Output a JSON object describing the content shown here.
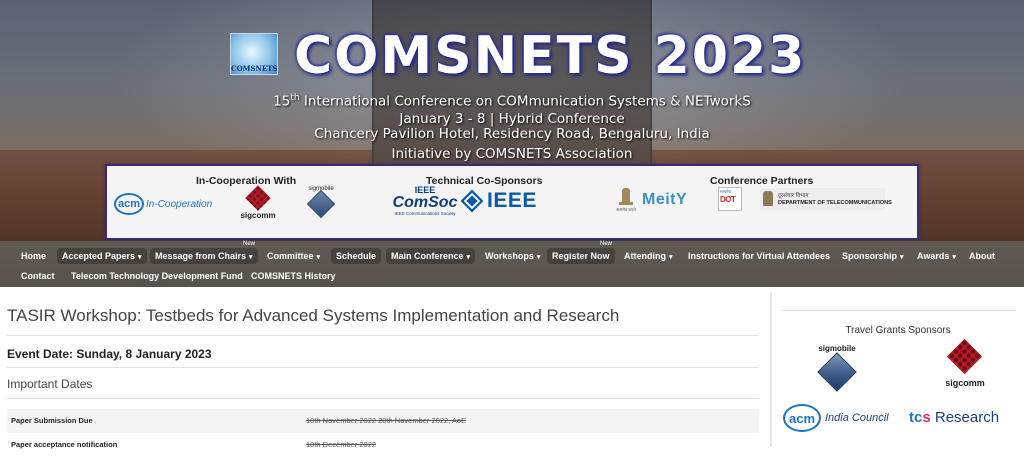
{
  "header": {
    "logo_text": "COMSNETS",
    "title": "COMSNETS 2023",
    "subtitle_ordinal": "15",
    "subtitle_suffix": "th",
    "subtitle_rest": " International Conference on COMmunication Systems & NETworkS",
    "dates_line": "January 3 - 8 | Hybrid Conference",
    "venue_line": "Chancery Pavilion Hotel, Residency Road, Bengaluru, India",
    "initiative_line": "Initiative by COMSNETS Association"
  },
  "sponsors_panel": {
    "cooperation_heading": "In-Cooperation With",
    "technical_heading": "Technical Co-Sponsors",
    "partners_heading": "Conference Partners",
    "acm_text": "acm",
    "acm_coop_text": "In-Cooperation",
    "sigcomm_text": "sigcomm",
    "sigmobile_text": "sigmobile",
    "comsoc_top": "IEEE",
    "comsoc_main": "ComSoc",
    "comsoc_tag": "IEEE Communications Society",
    "ieee_text": "IEEE",
    "emblem_text": "सत्यमेव जयते",
    "meity_text": "MeitY",
    "dot_top": "सत्यमेव",
    "dot_text": "DOT",
    "dept_line1": "दूरसंचार विभाग",
    "dept_line2": "DEPARTMENT OF TELECOMMUNICATIONS"
  },
  "nav": {
    "new_badge": "New",
    "items": [
      {
        "label": "Home",
        "caret": ""
      },
      {
        "label": "Accepted Papers",
        "caret": "▾"
      },
      {
        "label": "Message from Chairs",
        "caret": "▾"
      },
      {
        "label": "Committee",
        "caret": "▾"
      },
      {
        "label": "Schedule",
        "caret": ""
      },
      {
        "label": "Main Conference",
        "caret": "▾"
      },
      {
        "label": "Workshops",
        "caret": "▾"
      },
      {
        "label": "Register Now",
        "caret": ""
      },
      {
        "label": "Attending",
        "caret": "▾"
      },
      {
        "label": "Instructions for Virtual Attendees",
        "caret": ""
      },
      {
        "label": "Sponsorship",
        "caret": "▾"
      },
      {
        "label": "Awards",
        "caret": "▾"
      },
      {
        "label": "About",
        "caret": ""
      },
      {
        "label": "Contact",
        "caret": ""
      },
      {
        "label": "Telecom Technology Development Fund",
        "caret": ""
      },
      {
        "label": "COMSNETS History",
        "caret": ""
      }
    ]
  },
  "main": {
    "title": "TASIR Workshop: Testbeds for Advanced Systems Implementation and Research",
    "event_date": "Event Date: Sunday, 8 January 2023",
    "important_dates_heading": "Important Dates",
    "dates": [
      {
        "label": "Paper Submission Due",
        "value": "10th November 2022  20th November 2022, AoE"
      },
      {
        "label": "Paper acceptance notification",
        "value": "10th December 2022"
      }
    ]
  },
  "sidebar": {
    "title": "Travel Grants Sponsors",
    "sigmobile_text": "sigmobile",
    "sigcomm_text": "sigcomm",
    "acm_text": "acm",
    "acm_council_text": "India Council",
    "tcs_a": "tc",
    "tcs_b": "s",
    "tcs_c": " Research"
  },
  "colors": {
    "title_glow": "#2a2fa0",
    "panel_border": "#3b2a6e",
    "nav_bg": "#5f5a52",
    "acm_blue": "#1a73c7",
    "ieee_blue": "#0b5aa6",
    "sigcomm_red": "#b21d2a"
  }
}
